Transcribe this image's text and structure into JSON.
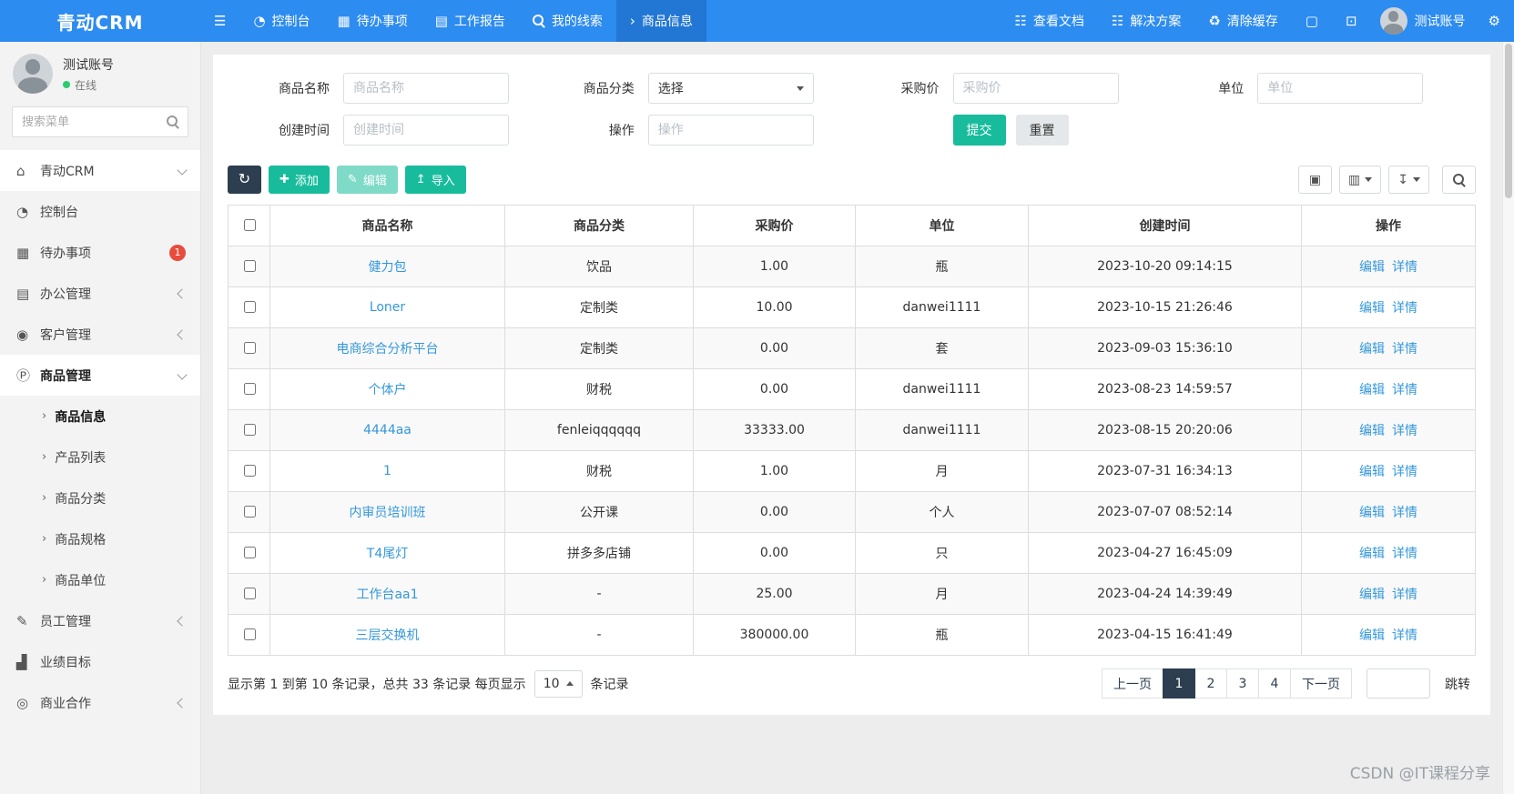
{
  "icons": {
    "hamburger": "☰",
    "dashboard": "◔",
    "calendar": "▦",
    "report": "▤",
    "arrow_right": "›",
    "sitemap": "☷",
    "trash": "♻",
    "file": "▢",
    "fullscreen": "⊡",
    "gear": "⚙",
    "home": "⌂",
    "office": "▤",
    "users": "◉",
    "product": "Ⓟ",
    "pencil": "✎",
    "chart": "▟",
    "coop": "◎",
    "refresh": "↻",
    "plus": "✚",
    "upload": "↥",
    "view": "▣",
    "columns": "▥",
    "export": "↧",
    "chevron_right": "›"
  },
  "topbar": {
    "brand": "青动CRM",
    "nav": [
      {
        "label": "控制台"
      },
      {
        "label": "待办事项"
      },
      {
        "label": "工作报告"
      },
      {
        "label": "我的线索"
      },
      {
        "label": "商品信息",
        "active": true
      }
    ],
    "links": [
      {
        "label": "查看文档"
      },
      {
        "label": "解决方案"
      },
      {
        "label": "清除缓存"
      }
    ],
    "username": "测试账号"
  },
  "sidebar": {
    "profile": {
      "name": "测试账号",
      "status": "在线"
    },
    "search_placeholder": "搜索菜单",
    "menu": [
      {
        "label": "青动CRM"
      },
      {
        "label": "控制台"
      },
      {
        "label": "待办事项",
        "badge": "1"
      },
      {
        "label": "办公管理"
      },
      {
        "label": "客户管理"
      },
      {
        "label": "商品管理"
      },
      {
        "label": "商品信息"
      },
      {
        "label": "产品列表"
      },
      {
        "label": "商品分类"
      },
      {
        "label": "商品规格"
      },
      {
        "label": "商品单位"
      },
      {
        "label": "员工管理"
      },
      {
        "label": "业绩目标"
      },
      {
        "label": "商业合作"
      }
    ]
  },
  "filters": {
    "fields": [
      {
        "label": "商品名称",
        "placeholder": "商品名称"
      },
      {
        "label": "商品分类",
        "value": "选择"
      },
      {
        "label": "采购价",
        "placeholder": "采购价"
      },
      {
        "label": "单位",
        "placeholder": "单位"
      },
      {
        "label": "创建时间",
        "placeholder": "创建时间"
      },
      {
        "label": "操作",
        "placeholder": "操作"
      }
    ],
    "submit": "提交",
    "reset": "重置"
  },
  "toolbar": {
    "add": "添加",
    "edit": "编辑",
    "import": "导入"
  },
  "table": {
    "columns": [
      "商品名称",
      "商品分类",
      "采购价",
      "单位",
      "创建时间",
      "操作"
    ],
    "edit_label": "编辑",
    "detail_label": "详情",
    "rows": [
      {
        "name": "健力包",
        "category": "饮品",
        "price": "1.00",
        "unit": "瓶",
        "created": "2023-10-20 09:14:15"
      },
      {
        "name": "Loner",
        "category": "定制类",
        "price": "10.00",
        "unit": "danwei1111",
        "created": "2023-10-15 21:26:46"
      },
      {
        "name": "电商综合分析平台",
        "category": "定制类",
        "price": "0.00",
        "unit": "套",
        "created": "2023-09-03 15:36:10"
      },
      {
        "name": "个体户",
        "category": "财税",
        "price": "0.00",
        "unit": "danwei1111",
        "created": "2023-08-23 14:59:57"
      },
      {
        "name": "4444aa",
        "category": "fenleiqqqqqq",
        "price": "33333.00",
        "unit": "danwei1111",
        "created": "2023-08-15 20:20:06"
      },
      {
        "name": "1",
        "category": "财税",
        "price": "1.00",
        "unit": "月",
        "created": "2023-07-31 16:34:13"
      },
      {
        "name": "内审员培训班",
        "category": "公开课",
        "price": "0.00",
        "unit": "个人",
        "created": "2023-07-07 08:52:14"
      },
      {
        "name": "T4尾灯",
        "category": "拼多多店铺",
        "price": "0.00",
        "unit": "只",
        "created": "2023-04-27 16:45:09"
      },
      {
        "name": "工作台aa1",
        "category": "-",
        "price": "25.00",
        "unit": "月",
        "created": "2023-04-24 14:39:49"
      },
      {
        "name": "三层交换机",
        "category": "-",
        "price": "380000.00",
        "unit": "瓶",
        "created": "2023-04-15 16:41:49"
      }
    ]
  },
  "pagination": {
    "info": "显示第 1 到第 10 条记录，总共 33 条记录 每页显示",
    "page_size": "10",
    "suffix": "条记录",
    "prev": "上一页",
    "next": "下一页",
    "pages": [
      {
        "label": "1",
        "active": true
      },
      {
        "label": "2"
      },
      {
        "label": "3"
      },
      {
        "label": "4"
      }
    ],
    "jump": "跳转"
  },
  "watermark": "CSDN @IT课程分享"
}
